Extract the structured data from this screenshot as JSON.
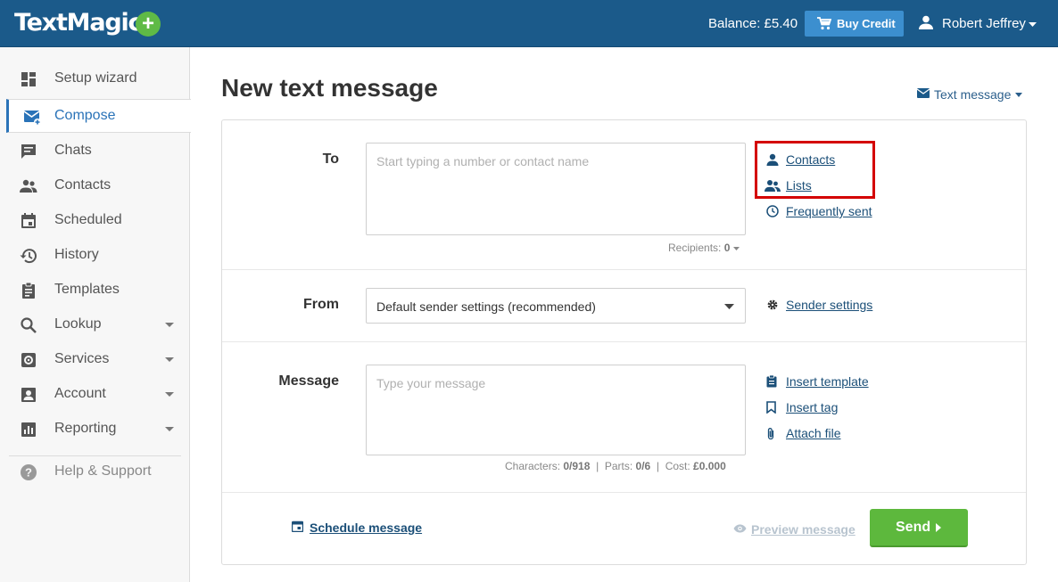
{
  "header": {
    "logo": "TextMagic",
    "balance": "Balance: £5.40",
    "buy_credit": "Buy Credit",
    "user_name": "Robert Jeffrey"
  },
  "sidebar": {
    "items": [
      {
        "label": "Setup wizard"
      },
      {
        "label": "Compose"
      },
      {
        "label": "Chats"
      },
      {
        "label": "Contacts"
      },
      {
        "label": "Scheduled"
      },
      {
        "label": "History"
      },
      {
        "label": "Templates"
      },
      {
        "label": "Lookup"
      },
      {
        "label": "Services"
      },
      {
        "label": "Account"
      },
      {
        "label": "Reporting"
      },
      {
        "label": "Help & Support"
      }
    ],
    "active": "Compose"
  },
  "main": {
    "title": "New text message",
    "message_type": "Text message",
    "to": {
      "label": "To",
      "placeholder": "Start typing a number or contact name",
      "recipients_label": "Recipients:",
      "recipients_count": "0",
      "links": [
        "Contacts",
        "Lists",
        "Frequently sent"
      ]
    },
    "from": {
      "label": "From",
      "selected": "Default sender settings (recommended)",
      "link": "Sender settings"
    },
    "message": {
      "label": "Message",
      "placeholder": "Type your message",
      "characters_label": "Characters:",
      "characters": "0/918",
      "parts_label": "Parts:",
      "parts": "0/6",
      "cost_label": "Cost:",
      "cost": "£0.000",
      "links": [
        "Insert template",
        "Insert tag",
        "Attach file"
      ]
    },
    "footer": {
      "schedule": "Schedule message",
      "preview": "Preview message",
      "send": "Send"
    }
  },
  "colors": {
    "header_bg": "#1b5a8a",
    "accent": "#2a73b8",
    "send_green": "#5db83d",
    "highlight_red": "#d40000"
  }
}
